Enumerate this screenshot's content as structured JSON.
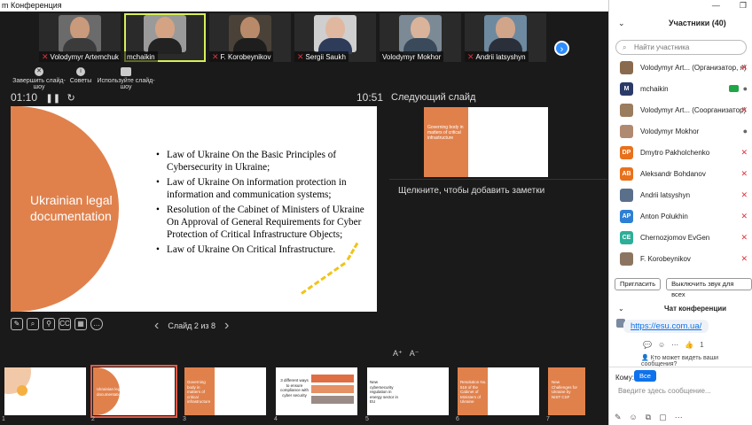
{
  "window_title": "m Конференция",
  "participants_strip": [
    {
      "name": "Volodymyr Artemchuk",
      "muted": true,
      "active": false
    },
    {
      "name": "mchaikin",
      "muted": false,
      "active": true
    },
    {
      "name": "F. Korobeynikov",
      "muted": true,
      "active": false
    },
    {
      "name": "Sergii Saukh",
      "muted": true,
      "active": false
    },
    {
      "name": "Volodymyr Mokhor",
      "muted": false,
      "active": false
    },
    {
      "name": "Andrii latsyshyn",
      "muted": true,
      "active": false
    }
  ],
  "controls": {
    "end_slideshow": "Завершить слайд-шоу",
    "tips": "Советы",
    "use_slideshow": "Используйте слайд-шоу"
  },
  "timer": {
    "elapsed": "01:10",
    "clock": "10:51"
  },
  "slide": {
    "title": "Ukrainian legal documentation",
    "bullets": [
      "Law of Ukraine On the Basic Principles of Cybersecurity in Ukraine;",
      "Law of Ukraine On information protection in information and communication systems;",
      "Resolution of the Cabinet of Ministers of Ukraine On Approval of General Requirements for Cyber Protection of Critical Infrastructure Objects;",
      "Law of Ukraine On Critical Infrastructure."
    ]
  },
  "slide_nav": {
    "label": "Слайд 2 из 8"
  },
  "next_slide": {
    "label": "Следующий слайд",
    "box_text": "Governing body in matters of critical infrastructure"
  },
  "notes_placeholder": "Щелкните, чтобы добавить заметки",
  "thumbnails": [
    {
      "num": "1",
      "text": ""
    },
    {
      "num": "2",
      "text": "Ukrainian legal documentation"
    },
    {
      "num": "3",
      "text": "Governing body in matters of critical infrastructure"
    },
    {
      "num": "4",
      "text": "3 different ways to ensure compliance with cyber security"
    },
    {
      "num": "5",
      "text": "New cybersecurity regulation in energy sector in EU"
    },
    {
      "num": "6",
      "text": "Resolution No. 518 of the Cabinet of Ministers of Ukraine"
    },
    {
      "num": "7",
      "text": "New Challenges for Ukraine by NIST CSF"
    }
  ],
  "panel": {
    "title": "Участники (40)",
    "search_placeholder": "Найти участника",
    "participants": [
      {
        "initials": "",
        "color": "#8a6a4e",
        "name": "Volodymyr Art... (Организатор, я)",
        "mic": "off"
      },
      {
        "initials": "M",
        "color": "#2b3a67",
        "name": "mchaikin",
        "mic": "on",
        "video": true
      },
      {
        "initials": "",
        "color": "#9a7c5e",
        "name": "Volodymyr Art... (Соорганизатор)",
        "mic": "off"
      },
      {
        "initials": "",
        "color": "#b08a70",
        "name": "Volodymyr Mokhor",
        "mic": "on"
      },
      {
        "initials": "DP",
        "color": "#e8711c",
        "name": "Dmytro Pakholchenko",
        "mic": "off"
      },
      {
        "initials": "AB",
        "color": "#e8711c",
        "name": "Aleksandr Bohdanov",
        "mic": "off"
      },
      {
        "initials": "",
        "color": "#5a6f8a",
        "name": "Andrii latsyshyn",
        "mic": "off"
      },
      {
        "initials": "AP",
        "color": "#2d7fd3",
        "name": "Anton Polukhin",
        "mic": "off"
      },
      {
        "initials": "CE",
        "color": "#2cae98",
        "name": "Chernozjomov EvGen",
        "mic": "off"
      },
      {
        "initials": "",
        "color": "#8c7560",
        "name": "F. Korobeynikov",
        "mic": "off"
      }
    ],
    "invite_button": "Пригласить",
    "unmute_button": "Выключить звук для всех",
    "chat_title": "Чат конференции",
    "chat_link": "https://esu.com.ua/",
    "chat_reaction_count": "1",
    "who_can_see": "Кто может видеть ваши сообщения?",
    "to_label": "Кому:",
    "to_value": "Все",
    "input_placeholder": "Введите здесь сообщение..."
  }
}
